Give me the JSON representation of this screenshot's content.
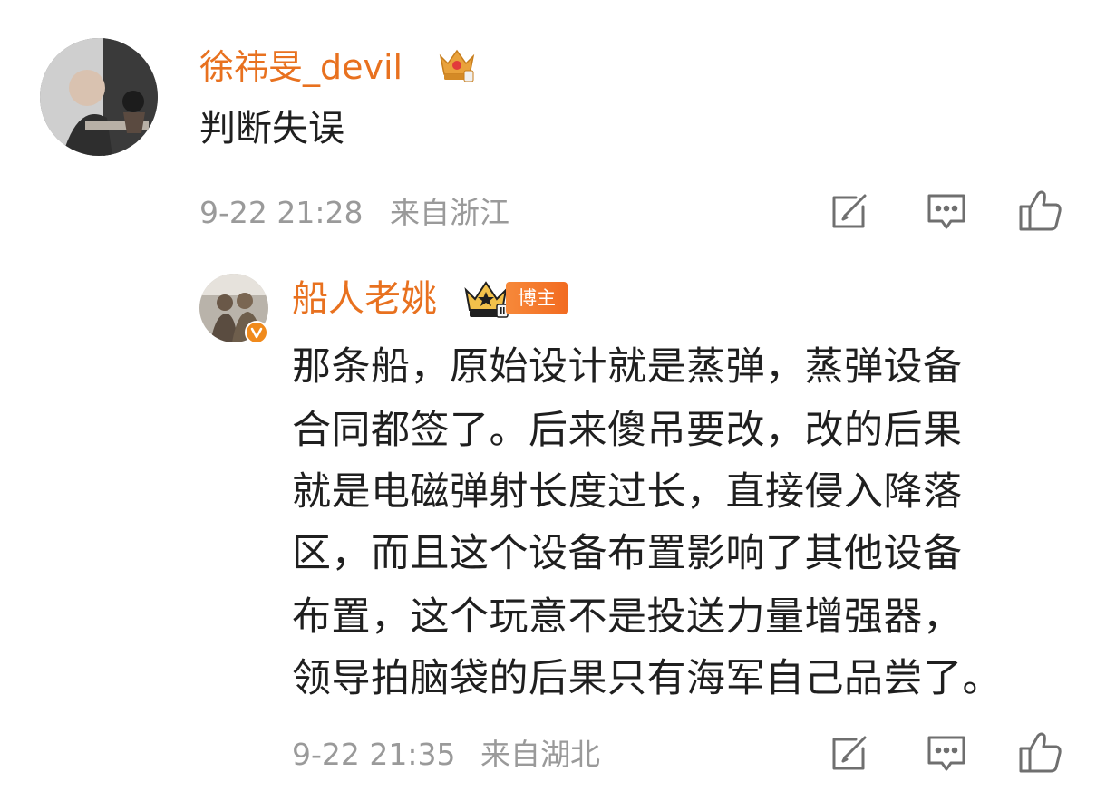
{
  "comment": {
    "username": "徐祎旻_devil",
    "text": "判断失误",
    "timestamp": "9-22 21:28",
    "location": "来自浙江",
    "actions": [
      "share-icon",
      "reply-icon",
      "like-icon"
    ]
  },
  "reply": {
    "username": "船人老姚",
    "badge_label": "博主",
    "lines": [
      "那条船，原始设计就是蒸弹，蒸弹设备",
      "合同都签了。后来傻吊要改，改的后果",
      "就是电磁弹射长度过长，直接侵入降落",
      "区，而且这个设备布置影响了其他设备",
      "布置，这个玩意不是投送力量增强器，",
      "领导拍脑袋的后果只有海军自己品尝了。"
    ],
    "timestamp": "9-22 21:35",
    "location": "来自湖北",
    "actions": [
      "share-icon",
      "reply-icon",
      "like-icon"
    ]
  },
  "colors": {
    "username": "#e8711f",
    "text": "#1f1f1f",
    "meta": "#9a9a9a",
    "icon": "#6f6f6f",
    "badge": "#f26b21",
    "crown": "#e9a23b"
  }
}
